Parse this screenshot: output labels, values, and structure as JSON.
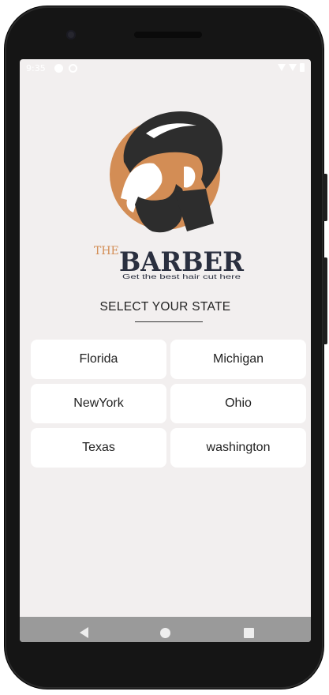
{
  "status": {
    "time": "9:35"
  },
  "brand": {
    "prefix": "THE",
    "name": "BARBER",
    "tagline": "Get the best hair cut here",
    "accent_color": "#d38d55",
    "dark_color": "#2a2f3f"
  },
  "page": {
    "title": "SELECT YOUR STATE"
  },
  "states": [
    {
      "label": "Florida"
    },
    {
      "label": "Michigan"
    },
    {
      "label": "NewYork"
    },
    {
      "label": "Ohio"
    },
    {
      "label": "Texas"
    },
    {
      "label": "washington"
    }
  ],
  "navbar": {
    "icons": [
      "back-icon",
      "home-icon",
      "recents-icon"
    ]
  }
}
